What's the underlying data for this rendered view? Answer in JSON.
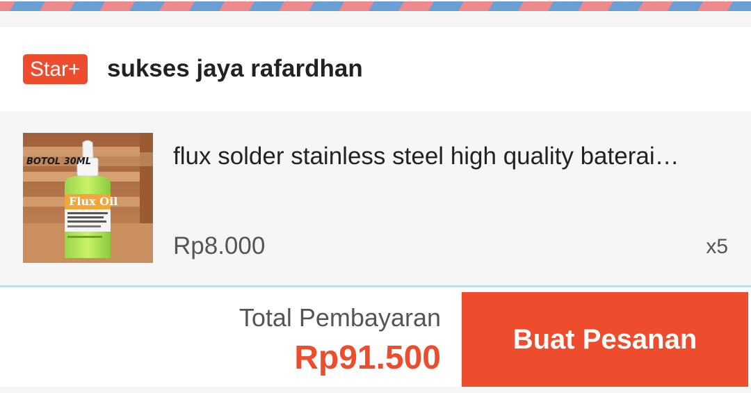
{
  "colors": {
    "accent": "#ee4d2d",
    "airmail_blue": "#6a9fd4",
    "airmail_red": "#ee8a8d",
    "divider": "#b9e3e7"
  },
  "shop": {
    "badge": "Star+",
    "name": "sukses jaya rafardhan"
  },
  "item": {
    "image_labels": {
      "bottle_size": "BOTOL 30ML",
      "brand": "Flux Oil"
    },
    "title": "flux solder stainless steel high quality baterai…",
    "price": "Rp8.000",
    "quantity": "x5"
  },
  "footer": {
    "total_label": "Total Pembayaran",
    "total_value": "Rp91.500",
    "order_button": "Buat Pesanan"
  }
}
